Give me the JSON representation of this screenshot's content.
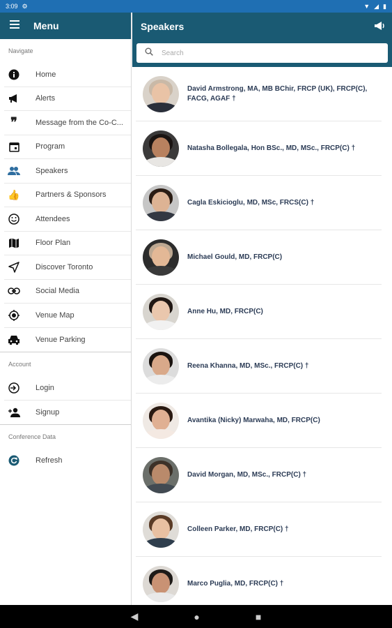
{
  "status": {
    "time": "3:09"
  },
  "menu": {
    "title": "Menu",
    "navigate_label": "Navigate",
    "account_label": "Account",
    "conference_label": "Conference Data",
    "navigate_items": [
      {
        "label": "Home",
        "icon": "info-icon"
      },
      {
        "label": "Alerts",
        "icon": "megaphone-icon"
      },
      {
        "label": "Message from the Co-C...",
        "icon": "quote-icon"
      },
      {
        "label": "Program",
        "icon": "calendar-icon"
      },
      {
        "label": "Speakers",
        "icon": "people-icon"
      },
      {
        "label": "Partners & Sponsors",
        "icon": "thumbs-up-icon"
      },
      {
        "label": "Attendees",
        "icon": "smiley-icon"
      },
      {
        "label": "Floor Plan",
        "icon": "map-icon"
      },
      {
        "label": "Discover Toronto",
        "icon": "send-icon"
      },
      {
        "label": "Social Media",
        "icon": "link-icon"
      },
      {
        "label": "Venue Map",
        "icon": "target-icon"
      },
      {
        "label": "Venue Parking",
        "icon": "car-icon"
      }
    ],
    "account_items": [
      {
        "label": "Login",
        "icon": "login-icon"
      },
      {
        "label": "Signup",
        "icon": "add-person-icon"
      }
    ],
    "conference_items": [
      {
        "label": "Refresh",
        "icon": "refresh-icon"
      }
    ]
  },
  "speakers": {
    "title": "Speakers",
    "search_placeholder": "Search",
    "list": [
      {
        "name": "David Armstrong, MA, MB BChir, FRCP (UK), FRCP(C), FACG, AGAF †",
        "skin": "#e9c3a6",
        "hair": "#c9b9a7",
        "shirt": "#2a2f3a",
        "bg": "#d9d2c9"
      },
      {
        "name": "Natasha Bollegala, Hon BSc., MD, MSc., FRCP(C) †",
        "skin": "#b8815f",
        "hair": "#1a1412",
        "shirt": "#e8e6e3",
        "bg": "#3b3a3a"
      },
      {
        "name": "Cagla Eskicioglu, MD, MSc, FRCS(C) †",
        "skin": "#ddb394",
        "hair": "#2a1c14",
        "shirt": "#333842",
        "bg": "#c6c6c6"
      },
      {
        "name": "Michael Gould, MD, FRCP(C)",
        "skin": "#e3b896",
        "hair": "#bda892",
        "shirt": "#3a3a3a",
        "bg": "#2c2c2c"
      },
      {
        "name": "Anne Hu, MD, FRCP(C)",
        "skin": "#eac7ad",
        "hair": "#201713",
        "shirt": "#f1f1f1",
        "bg": "#d8d5cf"
      },
      {
        "name": "Reena Khanna, MD, MSc., FRCP(C) †",
        "skin": "#d9a98a",
        "hair": "#1b1410",
        "shirt": "#ececec",
        "bg": "#dcdcdc"
      },
      {
        "name": "Avantika (Nicky) Marwaha, MD, FRCP(C)",
        "skin": "#e0b093",
        "hair": "#2a1a12",
        "shirt": "#f4e9e2",
        "bg": "#efe9e4"
      },
      {
        "name": "David Morgan, MD, MSc., FRCP(C) †",
        "skin": "#b98a6b",
        "hair": "#3c3128",
        "shirt": "#424a52",
        "bg": "#6b6f6a"
      },
      {
        "name": "Colleen Parker, MD, FRCP(C) †",
        "skin": "#e8c0a2",
        "hair": "#5a3b26",
        "shirt": "#2f3e4d",
        "bg": "#dfdcd7"
      },
      {
        "name": "Marco Puglia, MD, FRCP(C) †",
        "skin": "#c99274",
        "hair": "#1e1a18",
        "shirt": "#e9e9e9",
        "bg": "#ddd9d4"
      }
    ]
  },
  "colors": {
    "header": "#1a5a73",
    "status_bar": "#1f6fb3",
    "selected_icon": "#2f6ea0"
  }
}
